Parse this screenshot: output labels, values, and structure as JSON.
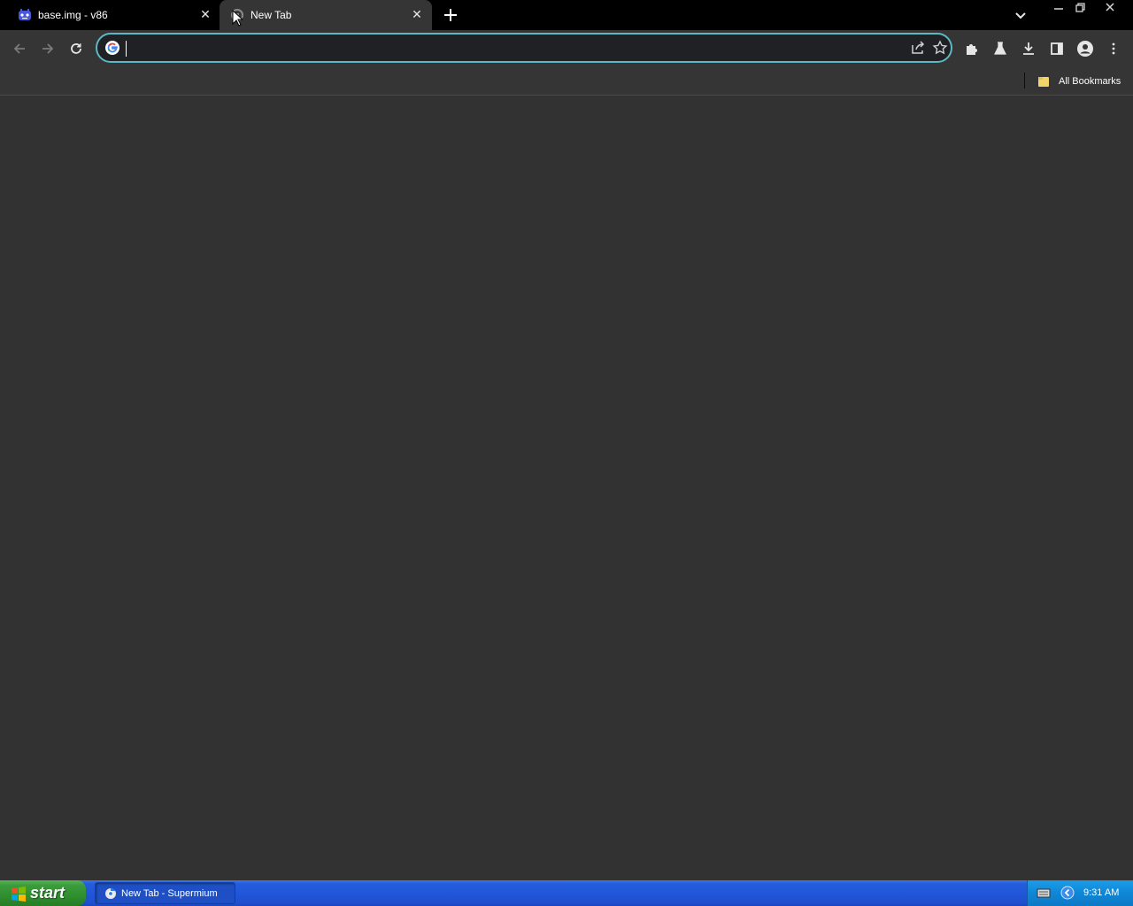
{
  "tabs": [
    {
      "title": "base.img - v86",
      "active": false,
      "favicon": "v86-icon"
    },
    {
      "title": "New Tab",
      "active": true,
      "favicon": "supermium-icon"
    }
  ],
  "toolbar": {
    "omnibox_value": "",
    "omnibox_placeholder": ""
  },
  "bookmarks": {
    "all_bookmarks_label": "All Bookmarks"
  },
  "taskbar": {
    "start_label": "start",
    "window_button_label": "New Tab - Supermium",
    "clock": "9:31 AM"
  },
  "colors": {
    "tabstrip": "#000000",
    "toolbar": "#353535",
    "omnibox_focus": "#5db8c4",
    "content": "#323232",
    "taskbar": "#245edc",
    "start_button": "#3c9b3c",
    "tray": "#0f87d6"
  }
}
